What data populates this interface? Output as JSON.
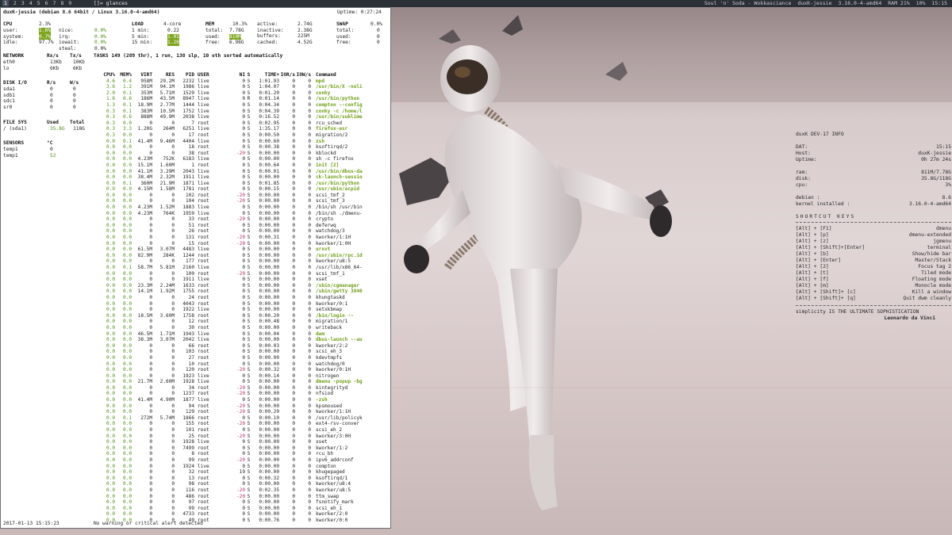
{
  "topbar": {
    "tags": [
      "1",
      "2",
      "3",
      "4",
      "5",
      "6",
      "7",
      "8",
      "9"
    ],
    "selected_tag": "1",
    "layout_symbol": "[]=",
    "window_title": "glances",
    "status": [
      "Soul 'n' Soda - Wokkasciance",
      "duxK-jessie",
      "3.16.0-4-amd64",
      "RAM 21%",
      "10%",
      "15:15"
    ]
  },
  "glances": {
    "host_line": "duxK-jessie (debian 8.6 64bit / Linux 3.16.0-4-amd64)",
    "uptime": "Uptime: 0:27:24",
    "cpu": {
      "label": "CPU",
      "total": "2.3%",
      "rows": [
        [
          "user:",
          "1.6%",
          "nice:",
          "0.0%"
        ],
        [
          "system:",
          "0.7%",
          "irq:",
          "0.0%"
        ],
        [
          "idle:",
          "97.7%",
          "iowait:",
          "0.0%"
        ],
        [
          "",
          "",
          "steal:",
          "0.0%"
        ]
      ]
    },
    "load": {
      "label": "LOAD",
      "cores": "4-core",
      "rows": [
        [
          "1 min:",
          "0.22"
        ],
        [
          "5 min:",
          "1.01"
        ],
        [
          "15 min:",
          "1.20"
        ]
      ]
    },
    "mem": {
      "label": "MEM",
      "pct": "10.3%",
      "rows": [
        [
          "total:",
          "7.78G"
        ],
        [
          "used:",
          "810M"
        ],
        [
          "free:",
          "6.98G"
        ]
      ],
      "right": [
        [
          "active:",
          "2.74G"
        ],
        [
          "inactive:",
          "2.38G"
        ],
        [
          "buffers:",
          "225M"
        ],
        [
          "cached:",
          "4.52G"
        ]
      ]
    },
    "swap": {
      "label": "SWAP",
      "pct": "0.0%",
      "rows": [
        [
          "total:",
          "0"
        ],
        [
          "used:",
          "0"
        ],
        [
          "free:",
          "0"
        ]
      ]
    },
    "network": {
      "header": [
        "NETWORK",
        "Rx/s",
        "Tx/s"
      ],
      "rows": [
        [
          "eth0",
          "13Kb",
          "10Kb"
        ],
        [
          "lo",
          "6Kb",
          "6Kb"
        ]
      ]
    },
    "disk": {
      "header": [
        "DISK I/O",
        "R/s",
        "W/s"
      ],
      "rows": [
        [
          "sda1",
          "0",
          "0"
        ],
        [
          "sdb1",
          "0",
          "0"
        ],
        [
          "sdc1",
          "0",
          "0"
        ],
        [
          "sr0",
          "0",
          "0"
        ]
      ]
    },
    "fs": {
      "header": [
        "FILE SYS",
        "Used",
        "Total"
      ],
      "rows": [
        [
          "/ (sda1)",
          "35.8G",
          "118G"
        ]
      ]
    },
    "sensors": {
      "header": [
        "SENSORS",
        "°C"
      ],
      "rows": [
        [
          "temp1",
          "0"
        ],
        [
          "temp1",
          "52"
        ]
      ]
    },
    "tasks_line": "TASKS 149 (289 thr), 1 run, 138 slp, 10 oth sorted automatically",
    "proc_headers": [
      "CPU%",
      "MEM%",
      "VIRT",
      "RES",
      "PID",
      "USER",
      "NI",
      "S",
      "TIME+",
      "IOR/s",
      "IOW/s",
      "Command"
    ],
    "processes": [
      [
        "4.6",
        "0.4",
        "958M",
        "29.2M",
        "2232",
        "live",
        "0",
        "S",
        "1:01.93",
        "0",
        "0",
        "mpd"
      ],
      [
        "3.6",
        "1.2",
        "391M",
        "94.1M",
        "1986",
        "live",
        "0",
        "S",
        "1:04.07",
        "0",
        "0",
        "/usr/bin/X -noli"
      ],
      [
        "2.0",
        "0.1",
        "353M",
        "5.71M",
        "1529",
        "live",
        "0",
        "S",
        "0:01.20",
        "0",
        "0",
        "conky"
      ],
      [
        "1.6",
        "0.6",
        "186M",
        "43.5M",
        "8947",
        "live",
        "0",
        "R",
        "0:01.14",
        "0",
        "0",
        "/usr/bin/python"
      ],
      [
        "1.3",
        "0.1",
        "18.9M",
        "2.77M",
        "1444",
        "live",
        "0",
        "S",
        "0:04.34",
        "0",
        "0",
        "compton --config"
      ],
      [
        "0.3",
        "0.1",
        "383M",
        "10.5M",
        "1752",
        "live",
        "0",
        "S",
        "0:04.39",
        "0",
        "0",
        "conky -c /home/l"
      ],
      [
        "0.3",
        "0.6",
        "888M",
        "49.9M",
        "2038",
        "live",
        "0",
        "S",
        "0:16.52",
        "0",
        "0",
        "/usr/bin/sublime"
      ],
      [
        "0.3",
        "0.0",
        "0",
        "0",
        "7",
        "root",
        "0",
        "S",
        "0:02.95",
        "0",
        "0",
        "rcu_sched"
      ],
      [
        "0.3",
        "3.3",
        "1.20G",
        "264M",
        "6251",
        "live",
        "0",
        "S",
        "1:35.17",
        "0",
        "0",
        "firefox-esr"
      ],
      [
        "0.3",
        "0.0",
        "0",
        "0",
        "17",
        "root",
        "0",
        "S",
        "0:00.50",
        "0",
        "0",
        "migration/2"
      ],
      [
        "0.0",
        "0.1",
        "41.4M",
        "9.46M",
        "4404",
        "live",
        "0",
        "S",
        "0:00.60",
        "0",
        "0",
        "zsh"
      ],
      [
        "0.0",
        "0.0",
        "0",
        "0",
        "18",
        "root",
        "0",
        "S",
        "0:00.38",
        "0",
        "0",
        "ksoftirqd/2"
      ],
      [
        "0.0",
        "0.0",
        "0",
        "0",
        "38",
        "root",
        "-20",
        "S",
        "0:00.00",
        "0",
        "0",
        "kblockd"
      ],
      [
        "0.0",
        "0.0",
        "4.23M",
        "752K",
        "6183",
        "live",
        "0",
        "S",
        "0:00.00",
        "0",
        "0",
        "sh -c firefox"
      ],
      [
        "0.0",
        "0.0",
        "15.1M",
        "1.60M",
        "1",
        "root",
        "0",
        "S",
        "0:00.64",
        "0",
        "0",
        "init [2]"
      ],
      [
        "0.0",
        "0.0",
        "41.1M",
        "3.29M",
        "2043",
        "live",
        "0",
        "S",
        "0:00.01",
        "0",
        "0",
        "/usr/bin/dbus-da"
      ],
      [
        "0.0",
        "0.0",
        "38.4M",
        "2.32M",
        "1911",
        "live",
        "0",
        "S",
        "0:00.00",
        "0",
        "0",
        "ck-launch-sessio"
      ],
      [
        "0.0",
        "0.1",
        "360M",
        "21.9M",
        "1871",
        "live",
        "0",
        "S",
        "0:01.85",
        "0",
        "0",
        "/usr/bin/python"
      ],
      [
        "0.0",
        "0.0",
        "4.15M",
        "1.58M",
        "1781",
        "root",
        "0",
        "S",
        "0:00.15",
        "0",
        "0",
        "/usr/sbin/acpid"
      ],
      [
        "0.0",
        "0.0",
        "0",
        "0",
        "102",
        "root",
        "-20",
        "S",
        "0:00.00",
        "0",
        "0",
        "scsi_tmf_2"
      ],
      [
        "0.0",
        "0.0",
        "0",
        "0",
        "104",
        "root",
        "-20",
        "S",
        "0:00.00",
        "0",
        "0",
        "scsi_tmf_3"
      ],
      [
        "0.0",
        "0.0",
        "4.23M",
        "1.52M",
        "1883",
        "live",
        "0",
        "S",
        "0:00.00",
        "0",
        "0",
        "/bin/sh /usr/bin"
      ],
      [
        "0.0",
        "0.0",
        "4.23M",
        "764K",
        "1959",
        "live",
        "0",
        "S",
        "0:00.00",
        "0",
        "0",
        "/bin/sh ./dmenu-"
      ],
      [
        "0.0",
        "0.0",
        "0",
        "0",
        "33",
        "root",
        "-20",
        "S",
        "0:00.00",
        "0",
        "0",
        "crypto"
      ],
      [
        "0.0",
        "0.0",
        "0",
        "0",
        "51",
        "root",
        "0",
        "S",
        "0:00.00",
        "0",
        "0",
        "deferwq"
      ],
      [
        "0.0",
        "0.0",
        "0",
        "0",
        "26",
        "root",
        "0",
        "S",
        "0:00.00",
        "0",
        "0",
        "watchdog/3"
      ],
      [
        "0.0",
        "0.0",
        "0",
        "0",
        "131",
        "root",
        "-20",
        "S",
        "0:00.31",
        "0",
        "0",
        "kworker/1:1H"
      ],
      [
        "0.0",
        "0.0",
        "0",
        "0",
        "15",
        "root",
        "-20",
        "S",
        "0:00.00",
        "0",
        "0",
        "kworker/1:0H"
      ],
      [
        "0.0",
        "0.0",
        "61.5M",
        "3.07M",
        "4483",
        "live",
        "0",
        "S",
        "0:00.00",
        "0",
        "0",
        "urxvt"
      ],
      [
        "0.0",
        "0.0",
        "82.9M",
        "284K",
        "1244",
        "root",
        "0",
        "S",
        "0:00.00",
        "0",
        "0",
        "/usr/sbin/rpc.id"
      ],
      [
        "0.0",
        "0.0",
        "0",
        "0",
        "177",
        "root",
        "0",
        "S",
        "0:00.00",
        "0",
        "0",
        "kworker/u8:5"
      ],
      [
        "0.0",
        "0.1",
        "58.7M",
        "5.81M",
        "2160",
        "live",
        "0",
        "S",
        "0:00.00",
        "0",
        "0",
        "/usr/lib/x86_64-"
      ],
      [
        "0.0",
        "0.0",
        "0",
        "0",
        "100",
        "root",
        "-20",
        "S",
        "0:00.00",
        "0",
        "0",
        "scsi_tmf_1"
      ],
      [
        "0.0",
        "0.0",
        "0",
        "0",
        "1911",
        "live",
        "0",
        "S",
        "0:00.00",
        "0",
        "0",
        "xset"
      ],
      [
        "0.0",
        "0.0",
        "23.3M",
        "2.24M",
        "1633",
        "root",
        "0",
        "S",
        "0:00.00",
        "0",
        "0",
        "/sbin/cgmanager"
      ],
      [
        "0.0",
        "0.0",
        "14.1M",
        "1.92M",
        "1755",
        "root",
        "0",
        "S",
        "0:00.00",
        "0",
        "0",
        "/sbin/getty 3840"
      ],
      [
        "0.0",
        "0.0",
        "0",
        "0",
        "24",
        "root",
        "0",
        "S",
        "0:00.00",
        "0",
        "0",
        "khungtaskd"
      ],
      [
        "0.0",
        "0.0",
        "0",
        "0",
        "4043",
        "root",
        "0",
        "S",
        "0:00.00",
        "0",
        "0",
        "kworker/0:1"
      ],
      [
        "0.0",
        "0.0",
        "0",
        "0",
        "1922",
        "live",
        "0",
        "S",
        "0:00.00",
        "0",
        "0",
        "setxkbmap"
      ],
      [
        "0.0",
        "0.0",
        "18.5M",
        "3.60M",
        "1758",
        "root",
        "0",
        "S",
        "0:00.20",
        "0",
        "0",
        "/bin/login --"
      ],
      [
        "0.0",
        "0.0",
        "0",
        "0",
        "12",
        "root",
        "0",
        "S",
        "0:00.48",
        "0",
        "0",
        "migration/1"
      ],
      [
        "0.0",
        "0.0",
        "0",
        "0",
        "30",
        "root",
        "0",
        "S",
        "0:00.00",
        "0",
        "0",
        "writeback"
      ],
      [
        "0.0",
        "0.0",
        "46.5M",
        "1.71M",
        "1943",
        "live",
        "0",
        "S",
        "0:00.04",
        "0",
        "0",
        "dwm"
      ],
      [
        "0.0",
        "0.0",
        "38.3M",
        "3.07M",
        "2042",
        "live",
        "0",
        "S",
        "0:00.00",
        "0",
        "0",
        "dbus-launch --au"
      ],
      [
        "0.0",
        "0.0",
        "0",
        "0",
        "66",
        "root",
        "0",
        "S",
        "0:00.03",
        "0",
        "0",
        "kworker/2:2"
      ],
      [
        "0.0",
        "0.0",
        "0",
        "0",
        "103",
        "root",
        "0",
        "S",
        "0:00.00",
        "0",
        "0",
        "scsi_eh_3"
      ],
      [
        "0.0",
        "0.0",
        "0",
        "0",
        "27",
        "root",
        "0",
        "S",
        "0:00.00",
        "0",
        "0",
        "kdevtmpfs"
      ],
      [
        "0.0",
        "0.0",
        "0",
        "0",
        "10",
        "root",
        "0",
        "S",
        "0:00.00",
        "0",
        "0",
        "watchdog/0"
      ],
      [
        "0.0",
        "0.0",
        "0",
        "0",
        "120",
        "root",
        "-20",
        "S",
        "0:00.32",
        "0",
        "0",
        "kworker/0:1H"
      ],
      [
        "0.0",
        "0.0",
        "0",
        "0",
        "1923",
        "live",
        "0",
        "S",
        "0:00.14",
        "0",
        "0",
        "nitrogen"
      ],
      [
        "0.0",
        "0.0",
        "21.7M",
        "2.60M",
        "1928",
        "live",
        "0",
        "S",
        "0:00.00",
        "0",
        "0",
        "dmenu -popup -bg"
      ],
      [
        "0.0",
        "0.0",
        "0",
        "0",
        "34",
        "root",
        "-20",
        "S",
        "0:00.00",
        "0",
        "0",
        "kintegrityd"
      ],
      [
        "0.0",
        "0.0",
        "0",
        "0",
        "1237",
        "root",
        "-20",
        "S",
        "0:00.00",
        "0",
        "0",
        "nfsiod"
      ],
      [
        "0.0",
        "0.0",
        "41.4M",
        "4.90M",
        "1877",
        "live",
        "0",
        "S",
        "0:00.00",
        "0",
        "0",
        "-zsh"
      ],
      [
        "0.0",
        "0.0",
        "0",
        "0",
        "94",
        "root",
        "-20",
        "S",
        "0:00.00",
        "0",
        "0",
        "kpsmoused"
      ],
      [
        "0.0",
        "0.0",
        "0",
        "0",
        "129",
        "root",
        "-20",
        "S",
        "0:00.29",
        "0",
        "0",
        "kworker/1:1H"
      ],
      [
        "0.0",
        "0.1",
        "272M",
        "5.74M",
        "1866",
        "root",
        "0",
        "S",
        "0:00.10",
        "0",
        "0",
        "/usr/lib/policyk"
      ],
      [
        "0.0",
        "0.0",
        "0",
        "0",
        "155",
        "root",
        "-20",
        "S",
        "0:00.00",
        "0",
        "0",
        "ext4-rsv-conver"
      ],
      [
        "0.0",
        "0.0",
        "0",
        "0",
        "101",
        "root",
        "0",
        "S",
        "0:00.00",
        "0",
        "0",
        "scsi_eh_2"
      ],
      [
        "0.0",
        "0.0",
        "0",
        "0",
        "25",
        "root",
        "-20",
        "S",
        "0:00.00",
        "0",
        "0",
        "kworker/3:0H"
      ],
      [
        "0.0",
        "0.0",
        "0",
        "0",
        "1928",
        "live",
        "0",
        "S",
        "0:00.00",
        "0",
        "0",
        "xset"
      ],
      [
        "0.0",
        "0.0",
        "0",
        "0",
        "7499",
        "root",
        "0",
        "S",
        "0:00.00",
        "0",
        "0",
        "kworker/1:2"
      ],
      [
        "0.0",
        "0.0",
        "0",
        "0",
        "8",
        "root",
        "0",
        "S",
        "0:00.00",
        "0",
        "0",
        "rcu_bh"
      ],
      [
        "0.0",
        "0.0",
        "0",
        "0",
        "99",
        "root",
        "-20",
        "S",
        "0:00.00",
        "0",
        "0",
        "ipv6_addrconf"
      ],
      [
        "0.0",
        "0.0",
        "0",
        "0",
        "1924",
        "live",
        "0",
        "S",
        "0:00.00",
        "0",
        "0",
        "compton"
      ],
      [
        "0.0",
        "0.0",
        "0",
        "0",
        "32",
        "root",
        "19",
        "S",
        "0:00.00",
        "0",
        "0",
        "khugepaged"
      ],
      [
        "0.0",
        "0.0",
        "0",
        "0",
        "13",
        "root",
        "0",
        "S",
        "0:00.32",
        "0",
        "0",
        "ksoftirqd/1"
      ],
      [
        "0.0",
        "0.0",
        "0",
        "0",
        "98",
        "root",
        "0",
        "S",
        "0:00.00",
        "0",
        "0",
        "kworker/u8:4"
      ],
      [
        "0.0",
        "0.0",
        "0",
        "0",
        "116",
        "root",
        "-20",
        "S",
        "0:02.35",
        "0",
        "0",
        "kworker/u8:5"
      ],
      [
        "0.0",
        "0.0",
        "0",
        "0",
        "486",
        "root",
        "-20",
        "S",
        "0:00.00",
        "0",
        "0",
        "ttm_swap"
      ],
      [
        "0.0",
        "0.0",
        "0",
        "0",
        "97",
        "root",
        "0",
        "S",
        "0:00.00",
        "0",
        "0",
        "fsnotify_mark"
      ],
      [
        "0.0",
        "0.0",
        "0",
        "0",
        "99",
        "root",
        "0",
        "S",
        "0:00.00",
        "0",
        "0",
        "scsi_eh_1"
      ],
      [
        "0.0",
        "0.0",
        "0",
        "0",
        "4733",
        "root",
        "0",
        "S",
        "0:00.00",
        "0",
        "0",
        "kworker/2:0"
      ],
      [
        "0.0",
        "0.0",
        "0",
        "0",
        "49",
        "root",
        "0",
        "S",
        "0:00.76",
        "0",
        "0",
        "kworker/0:0"
      ]
    ],
    "footer_time": "2017-01-13 15:15:23",
    "footer_msg": "No warning or critical alert detected"
  },
  "info_panel": {
    "title": "duxK DEV-17 INFO",
    "rows": [
      [
        "DAT:",
        "15:15"
      ],
      [
        "Host:",
        "duxK-jessie"
      ],
      [
        "Uptime:",
        "0h 27m 24s"
      ]
    ],
    "rows2": [
      [
        "ram:",
        "811M/7.78G"
      ],
      [
        "disk:",
        "35.8G/118G"
      ],
      [
        "cpu:",
        "3%"
      ]
    ],
    "rows3": [
      [
        "debian :",
        "8.6"
      ],
      [
        "kernel installed :",
        "3.16.0-4-amd64"
      ]
    ],
    "shortcut_title": "SHORTCUT KEYS",
    "shortcuts": [
      [
        "[Alt] + [F1]",
        "dmenu"
      ],
      [
        "[Alt] + [p]",
        "dmenu-extended"
      ],
      [
        "[Alt] + [z]",
        "jgmenu"
      ],
      [
        "[Alt] + [Shift]+[Enter]",
        "terminal"
      ],
      [
        "[Alt] + [b]",
        "Show/hide bar"
      ],
      [
        "[Alt] + [Enter]",
        "Master/Stack"
      ],
      [
        "[Alt] + [2]",
        "Focus tag 2"
      ],
      [
        "[Alt] + [t]",
        "Tiled mode"
      ],
      [
        "[Alt] + [f]",
        "Floating mode"
      ],
      [
        "[Alt] + [m]",
        "Monocle mode"
      ],
      [
        "[Alt] + [Shift]+ [c]",
        "Kill a window"
      ],
      [
        "[Alt] + [Shift]+ [q]",
        "Quit dwm cleanly"
      ]
    ],
    "quote": "simplicity IS THE ULTIMATE SOPHISTICATION",
    "author": "Leonardo da Vinci"
  }
}
